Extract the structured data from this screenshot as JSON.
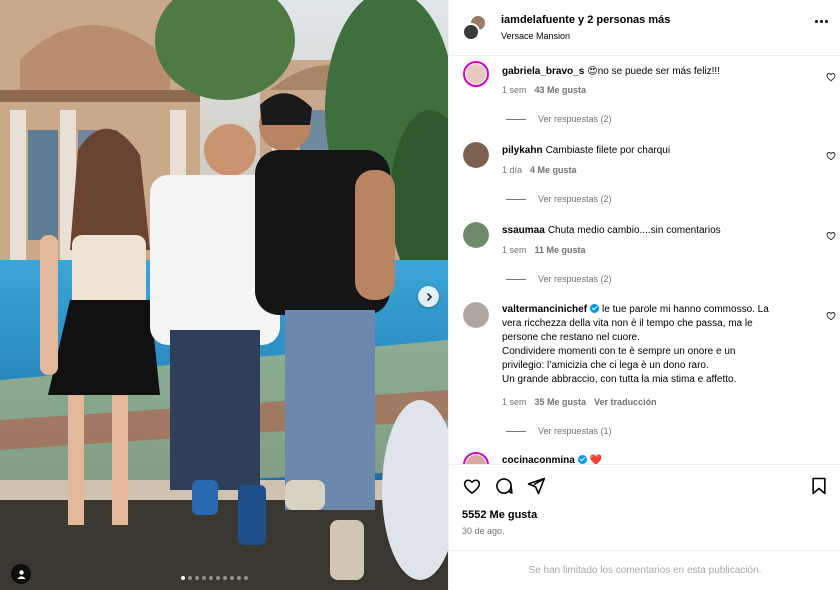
{
  "post": {
    "header": {
      "user": "iamdelafuente",
      "connector": " y ",
      "others": "2 personas más",
      "location": "Versace Mansion"
    },
    "carousel": {
      "total_slides": 10,
      "active_slide": 1
    },
    "comments": [
      {
        "username": "gabriela_bravo_s",
        "emoji": "😍",
        "text": "no se puede ser más feliz!!!",
        "time": "1 sem",
        "likes": "43 Me gusta",
        "replies": "Ver respuestas (2)",
        "avatar_color": "#e8c9c0",
        "verified": false
      },
      {
        "username": "pilykahn",
        "text": "Cambiaste filete por charqui",
        "time": "1 día",
        "likes": "4 Me gusta",
        "replies": "Ver respuestas (2)",
        "avatar_color": "#7a6150",
        "verified": false
      },
      {
        "username": "ssaumaa",
        "text": "Chuta medio cambio....sin comentarios",
        "time": "1 sem",
        "likes": "11 Me gusta",
        "replies": "Ver respuestas (2)",
        "avatar_color": "#6f8a6a",
        "verified": false
      },
      {
        "username": "valtermancinichef",
        "text_lines": [
          "le tue parole mi hanno commosso. La",
          "vera ricchezza della vita non è il tempo che passa, ma le",
          "persone che restano nel cuore.",
          "Condividere momenti con te è sempre un onore e un",
          "privilegio: l’amicizia che ci lega è un dono raro.",
          "Un grande abbraccio, con tutta la mia stima e affetto."
        ],
        "time": "1 sem",
        "likes": "35 Me gusta",
        "translate": "Ver traducción",
        "replies": "Ver respuestas (1)",
        "avatar_color": "#b0a8a0",
        "verified": true
      },
      {
        "username": "cocinaconmina",
        "emoji": "❤️",
        "avatar_color": "#d9a6a0",
        "verified": true
      }
    ],
    "likes_total": "5552 Me gusta",
    "date": "30 de ago.",
    "footer_notice": "Se han limitado los comentarios en esta publicación."
  },
  "colors": {
    "accent_blue": "#0095f6",
    "meta_gray": "#737373",
    "story_ring": "#d300c5",
    "divider": "#efefef"
  },
  "icons": [
    "more-icon",
    "heart-icon",
    "comment-icon",
    "share-icon",
    "save-icon",
    "next-arrow-icon",
    "user-tag-icon"
  ]
}
